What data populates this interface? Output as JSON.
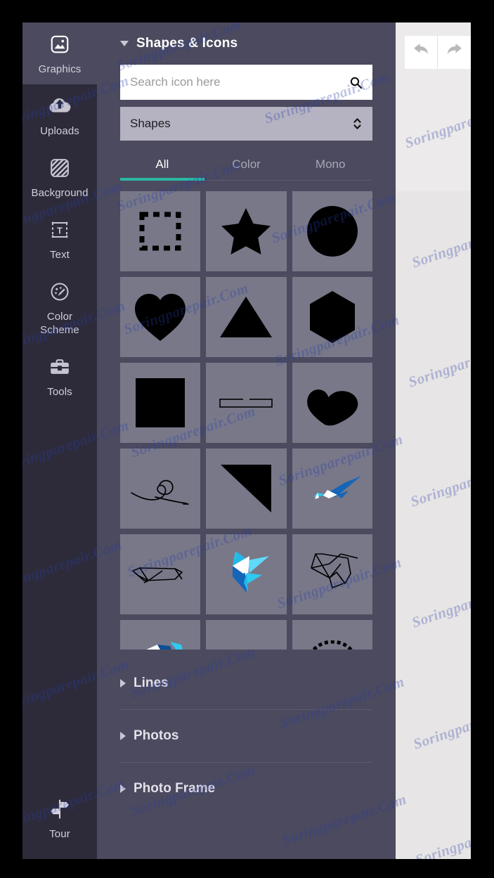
{
  "rail": {
    "items": [
      {
        "label": "Graphics",
        "icon": "image-icon",
        "active": true
      },
      {
        "label": "Uploads",
        "icon": "cloud-upload-icon",
        "active": false
      },
      {
        "label": "Background",
        "icon": "hatch-square-icon",
        "active": false
      },
      {
        "label": "Text",
        "icon": "text-box-icon",
        "active": false
      },
      {
        "label": "Color\nScheme",
        "icon": "palette-icon",
        "active": false
      },
      {
        "label": "Tools",
        "icon": "toolbox-icon",
        "active": false
      }
    ],
    "bottom": {
      "label": "Tour",
      "icon": "signpost-icon"
    }
  },
  "panel": {
    "section": {
      "title": "Shapes & Icons",
      "expanded": true,
      "caret_icon": "caret-down-icon"
    },
    "search": {
      "value": "",
      "placeholder": "Search icon here",
      "icon": "search-icon"
    },
    "select": {
      "value": "Shapes",
      "icon": "chevron-updown-icon",
      "options": [
        "Shapes"
      ]
    },
    "tabs": [
      {
        "label": "All",
        "active": true
      },
      {
        "label": "Color",
        "active": false
      },
      {
        "label": "Mono",
        "active": false
      }
    ],
    "grid": [
      {
        "name": "dashed-square-shape"
      },
      {
        "name": "star-shape"
      },
      {
        "name": "circle-shape"
      },
      {
        "name": "heart-shape"
      },
      {
        "name": "triangle-shape"
      },
      {
        "name": "hexagon-shape"
      },
      {
        "name": "square-shape"
      },
      {
        "name": "bar-outline-shape"
      },
      {
        "name": "tilted-heart-shape"
      },
      {
        "name": "heart-swirl-line-shape"
      },
      {
        "name": "right-triangle-shape"
      },
      {
        "name": "blue-origami-wing-shape"
      },
      {
        "name": "wireframe-bird-shape"
      },
      {
        "name": "blue-origami-bird-shape"
      },
      {
        "name": "outline-origami-bird-shape"
      },
      {
        "name": "crystal-gem-shape"
      },
      {
        "name": "cyan-polygon-shape"
      },
      {
        "name": "dashed-arch-shape"
      }
    ],
    "accordion": [
      {
        "label": "Lines",
        "expanded": false
      },
      {
        "label": "Photos",
        "expanded": false
      },
      {
        "label": "Photo Frame",
        "expanded": false
      }
    ],
    "collapse_handle": {
      "icon": "caret-left-icon"
    }
  },
  "canvas": {
    "toolbar": [
      {
        "name": "undo-button",
        "icon": "undo-icon"
      },
      {
        "name": "redo-button",
        "icon": "redo-icon"
      }
    ]
  },
  "watermark": {
    "text": "Soringparepair.Com"
  },
  "colors": {
    "rail_bg": "#2d2b3a",
    "panel_bg": "#4b4a5e",
    "cell_bg": "#787889",
    "accent_teal": "#2ab8a5",
    "select_bg": "#b5b3c1",
    "canvas_bg": "#eceaea"
  }
}
